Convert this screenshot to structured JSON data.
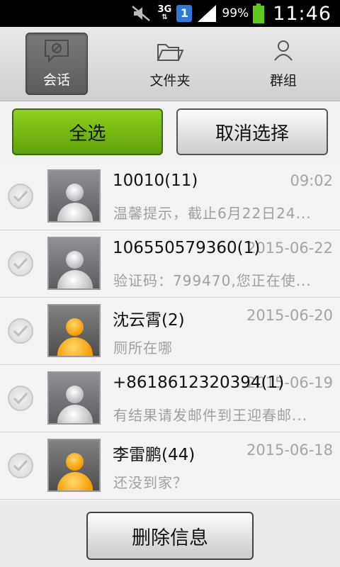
{
  "status_bar": {
    "network": "3G",
    "sim_slot": "1",
    "battery_percent": "99%",
    "time": "11:46"
  },
  "tabs": [
    {
      "label": "会话",
      "icon": "conversation-icon",
      "active": true
    },
    {
      "label": "文件夹",
      "icon": "folder-icon",
      "active": false
    },
    {
      "label": "群组",
      "icon": "person-icon",
      "active": false
    }
  ],
  "actions": {
    "select_all": "全选",
    "cancel_selection": "取消选择"
  },
  "messages": [
    {
      "name": "10010(11)",
      "time": "09:02",
      "preview": "温馨提示，截止6月22日24...",
      "avatar": "gray"
    },
    {
      "name": "106550579360(1)",
      "time": "2015-06-22",
      "preview": "验证码：799470,您正在使...",
      "avatar": "gray"
    },
    {
      "name": "沈云霄(2)",
      "time": "2015-06-20",
      "preview": "厕所在哪",
      "avatar": "orange"
    },
    {
      "name": "+8618612320394(1)",
      "time": "2015-06-19",
      "preview": "有结果请发邮件到王迎春邮...",
      "avatar": "gray"
    },
    {
      "name": "李雷鹏(44)",
      "time": "2015-06-18",
      "preview": "还没到家？",
      "avatar": "orange"
    }
  ],
  "bottom": {
    "delete_label": "删除信息"
  },
  "colors": {
    "accent_green": "#6fb414",
    "status_bar_bg": "#000000",
    "sim_blue": "#2e78d6",
    "battery_green": "#5cc91c"
  }
}
